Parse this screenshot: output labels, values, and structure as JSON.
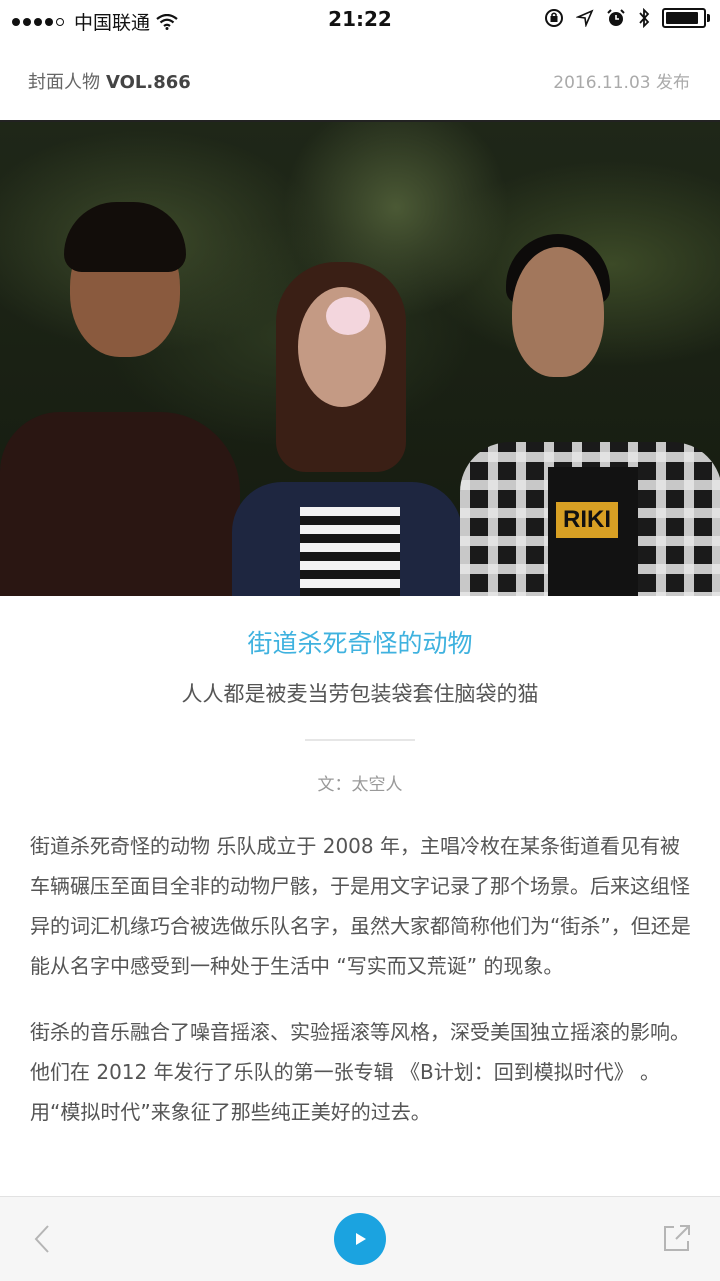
{
  "status_bar": {
    "carrier": "中国联通",
    "time": "21:22"
  },
  "header": {
    "section": "封面人物",
    "volume": "VOL.866",
    "published": "2016.11.03 发布"
  },
  "hero": {
    "shirt_print": "RIKI"
  },
  "article": {
    "title": "街道杀死奇怪的动物",
    "subtitle": "人人都是被麦当劳包装袋套住脑袋的猫",
    "author": "文：太空人",
    "paragraphs": [
      "街道杀死奇怪的动物 乐队成立于 2008 年，主唱冷枚在某条街道看见有被车辆碾压至面目全非的动物尸骸，于是用文字记录了那个场景。后来这组怪异的词汇机缘巧合被选做乐队名字，虽然大家都简称他们为“街杀”，但还是能从名字中感受到一种处于生活中 “写实而又荒诞” 的现象。",
      "街杀的音乐融合了噪音摇滚、实验摇滚等风格，深受美国独立摇滚的影响。他们在 2012 年发行了乐队的第一张专辑 《B计划：回到模拟时代》 。用“模拟时代”来象征了那些纯正美好的过去。"
    ]
  },
  "icons": {
    "wifi": "wifi-icon",
    "location": "location-arrow-icon",
    "alarm": "alarm-icon",
    "bluetooth": "bluetooth-icon",
    "battery": "battery-icon",
    "back": "chevron-left-icon",
    "play": "play-icon",
    "share": "share-icon"
  },
  "colors": {
    "accent": "#1ba3e0",
    "title": "#3fb2df"
  }
}
